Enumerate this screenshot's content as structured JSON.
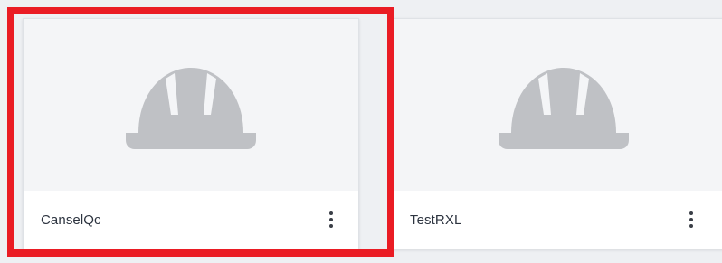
{
  "cards": [
    {
      "title": "CanselQc",
      "placeholder_icon": "hard-hat-icon",
      "menu_icon": "kebab-menu-icon",
      "selected": true
    },
    {
      "title": "TestRXL",
      "placeholder_icon": "hard-hat-icon",
      "menu_icon": "kebab-menu-icon",
      "selected": false
    }
  ],
  "colors": {
    "page_background": "#eef0f3",
    "card_media_background": "#f4f5f7",
    "icon_gray": "#bfc1c5",
    "selection_highlight": "#ea1c24",
    "title_text": "#2d3440"
  }
}
